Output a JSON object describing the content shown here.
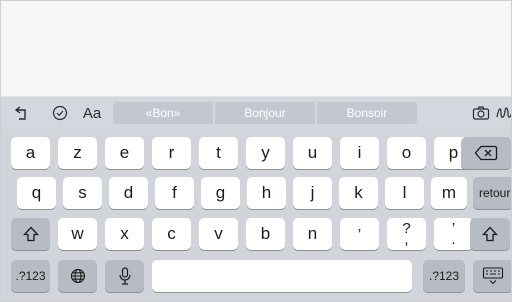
{
  "suggestions": [
    "«Bon»",
    "Bonjour",
    "Bonsoir"
  ],
  "shortcuts": {
    "format_label": "Aa"
  },
  "row1": [
    "a",
    "z",
    "e",
    "r",
    "t",
    "y",
    "u",
    "i",
    "o",
    "p"
  ],
  "row2": [
    "q",
    "s",
    "d",
    "f",
    "g",
    "h",
    "j",
    "k",
    "l",
    "m"
  ],
  "row2_return": "retour",
  "row3": [
    "w",
    "x",
    "c",
    "v",
    "b",
    "n"
  ],
  "row3_punct": [
    {
      "top": "",
      "bottom": "’"
    },
    {
      "top": "?",
      "bottom": ","
    },
    {
      "top": "’",
      "bottom": "."
    }
  ],
  "row4": {
    "numbers_left": ".?123",
    "numbers_right": ".?123"
  }
}
